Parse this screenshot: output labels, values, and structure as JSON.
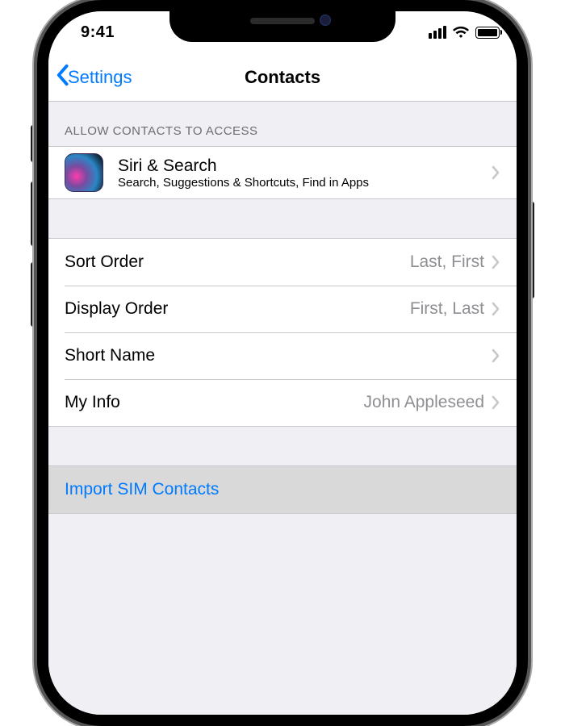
{
  "status": {
    "time": "9:41"
  },
  "nav": {
    "back_label": "Settings",
    "title": "Contacts"
  },
  "section1": {
    "header": "Allow Contacts to Access"
  },
  "siri_row": {
    "title": "Siri & Search",
    "subtitle": "Search, Suggestions & Shortcuts, Find in Apps"
  },
  "rows": {
    "sort_order": {
      "label": "Sort Order",
      "value": "Last, First"
    },
    "display_order": {
      "label": "Display Order",
      "value": "First, Last"
    },
    "short_name": {
      "label": "Short Name",
      "value": ""
    },
    "my_info": {
      "label": "My Info",
      "value": "John Appleseed"
    }
  },
  "import_row": {
    "label": "Import SIM Contacts"
  },
  "colors": {
    "tint": "#007aff",
    "separator": "#c7c7cc",
    "grouped_bg": "#efeff4",
    "secondary_text": "#8e8e93"
  }
}
